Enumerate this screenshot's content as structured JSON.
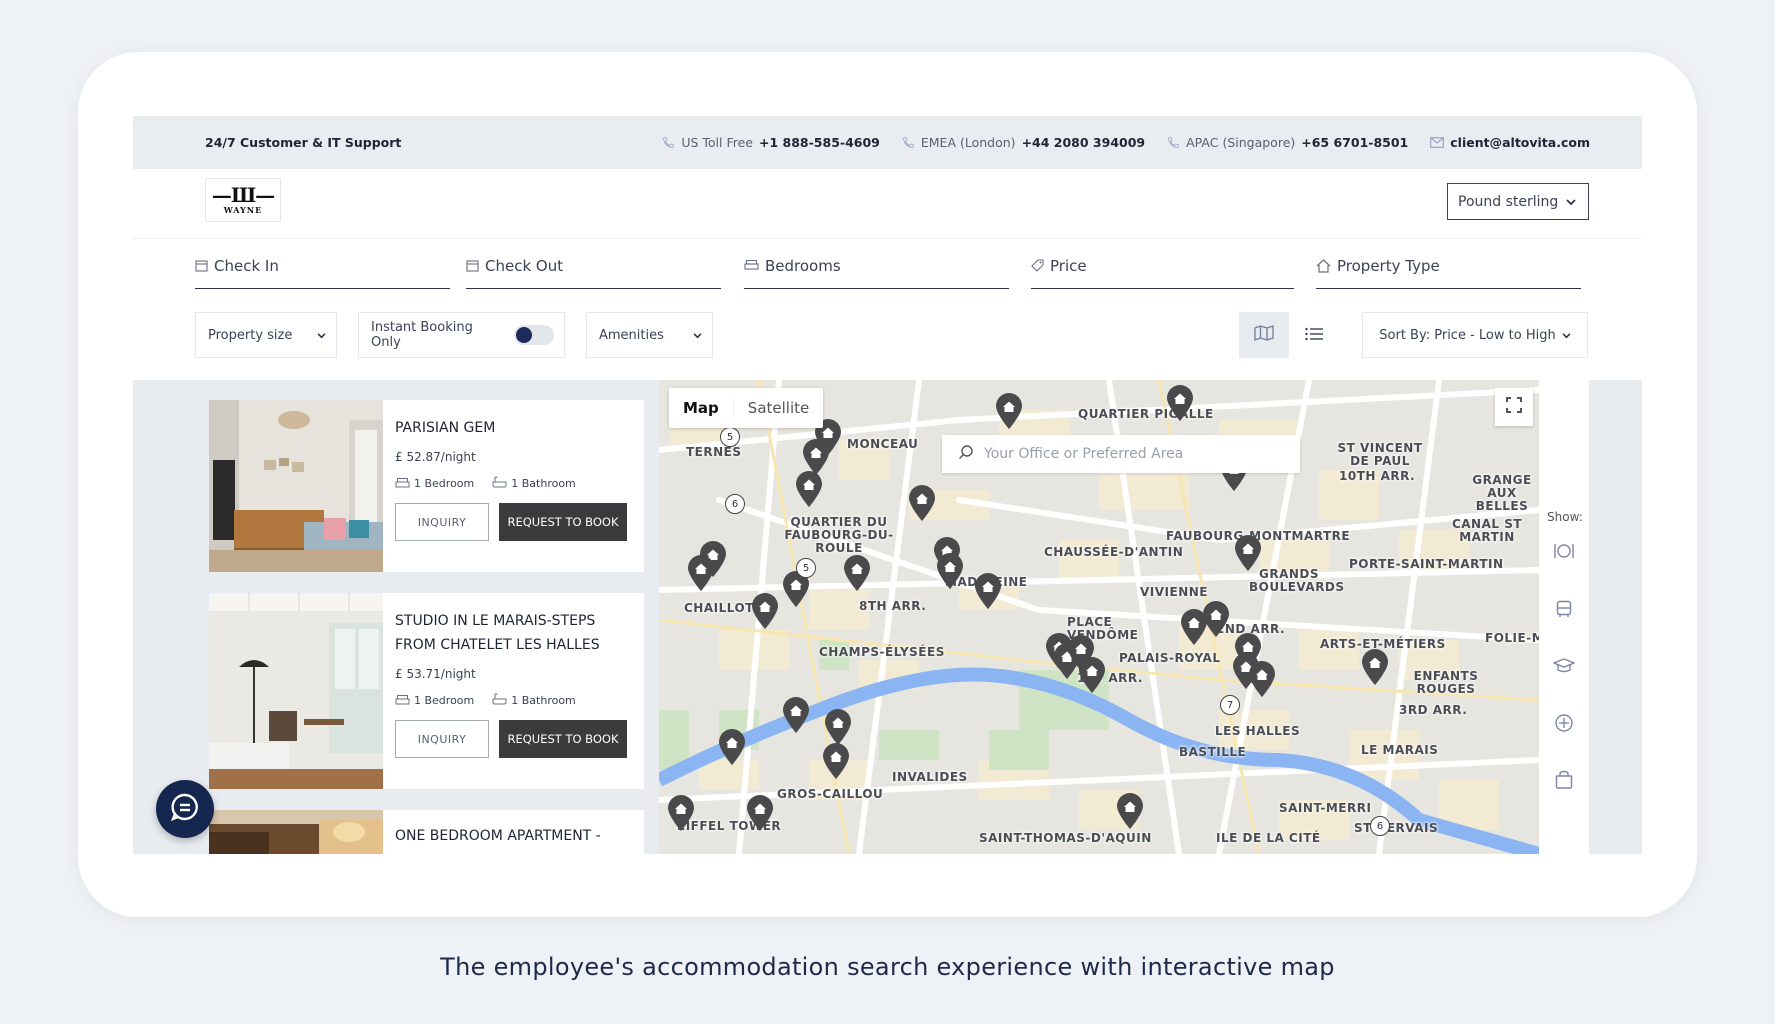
{
  "topbar": {
    "support": "24/7 Customer & IT Support",
    "contacts": [
      {
        "label": "US Toll Free",
        "value": "+1 888-585-4609"
      },
      {
        "label": "EMEA (London)",
        "value": "+44 2080 394009"
      },
      {
        "label": "APAC (Singapore)",
        "value": "+65 6701-8501"
      }
    ],
    "email": "client@altovita.com"
  },
  "header": {
    "logo_mark": "—Ш—",
    "logo_word": "WAYNE",
    "currency": "Pound sterling"
  },
  "filters": {
    "check_in": "Check In",
    "check_out": "Check Out",
    "bedrooms": "Bedrooms",
    "price": "Price",
    "property_type": "Property Type"
  },
  "controls": {
    "property_size": "Property size",
    "instant_booking": "Instant Booking Only",
    "amenities": "Amenities",
    "sort": "Sort By: Price - Low to High"
  },
  "listings": [
    {
      "title": "PARISIAN GEM",
      "price": "£ 52.87/night",
      "bedrooms": "1 Bedroom",
      "bathrooms": "1 Bathroom",
      "inquiry": "INQUIRY",
      "book": "REQUEST TO BOOK"
    },
    {
      "title": "STUDIO IN LE MARAIS-STEPS FROM CHATELET LES HALLES",
      "price": "£ 53.71/night",
      "bedrooms": "1 Bedroom",
      "bathrooms": "1 Bathroom",
      "inquiry": "INQUIRY",
      "book": "REQUEST TO BOOK"
    },
    {
      "title": "ONE BEDROOM APARTMENT -"
    }
  ],
  "map": {
    "tab_map": "Map",
    "tab_satellite": "Satellite",
    "search_placeholder": "Your Office or Preferred Area",
    "show_label": "Show:",
    "areas": [
      "QUARTIER PIGALLE",
      "MONCEAU",
      "TERNES",
      "ST VINCENT DE PAUL",
      "10TH ARR.",
      "GRANGE AUX BELLES",
      "QUARTIER DU FAUBOURG-DU-ROULE",
      "CHAUSSÉE-D'ANTIN",
      "FAUBOURG-MONTMARTRE",
      "CANAL ST MARTIN",
      "PORTE-SAINT-MARTIN",
      "CHAILLOT",
      "8TH ARR.",
      "MADELEINE",
      "VIVIENNE",
      "GRANDS BOULEVARDS",
      "2ND ARR.",
      "ARTS-ET-MÉTIERS",
      "FOLIE-M",
      "CHAMPS-ÉLYSÉES",
      "PLACE VENDÔME",
      "1ST ARR.",
      "PALAIS-ROYAL",
      "LES HALLES",
      "ENFANTS ROUGES",
      "3RD ARR.",
      "BASTILLE",
      "LE MARAIS",
      "INVALIDES",
      "GROS-CAILLOU",
      "SAINT-MERRI",
      "EIFFEL TOWER",
      "SAINT-THOMAS-D'AQUIN",
      "ILE DE LA CITÉ",
      "ST GERVAIS"
    ],
    "clusters": [
      "5",
      "6",
      "5",
      "7",
      "6"
    ]
  },
  "caption": "The employee's accommodation search experience with interactive map"
}
